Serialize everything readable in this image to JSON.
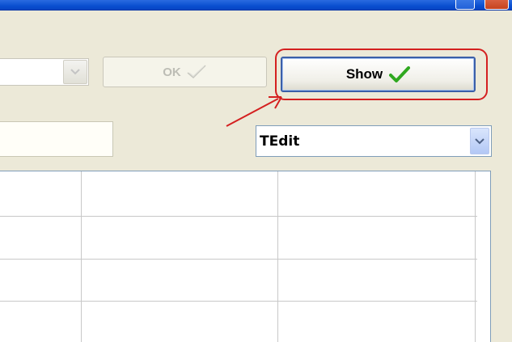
{
  "toolbar": {
    "ok_label": "OK",
    "show_label": "Show"
  },
  "component_select": {
    "selected": "TEdit"
  },
  "grid": {
    "rows": [
      [
        "",
        "",
        ""
      ],
      [
        "",
        "",
        ""
      ],
      [
        "",
        "",
        ""
      ],
      [
        "",
        "",
        ""
      ]
    ]
  },
  "colors": {
    "highlight": "#d42020",
    "check_green": "#2fa81f",
    "window_bg": "#ece9d8"
  },
  "icons": {
    "ok": "check-outline-icon",
    "show": "check-green-icon",
    "dropdown": "chevron-down-icon"
  }
}
